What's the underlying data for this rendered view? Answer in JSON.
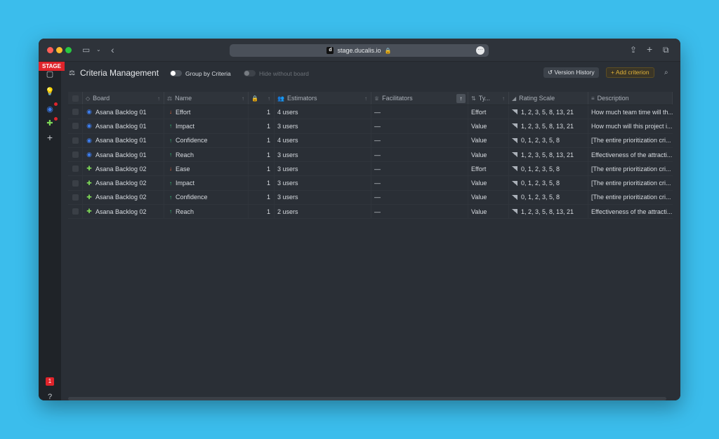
{
  "browser": {
    "url": "stage.ducalis.io",
    "favicon_letter": "d"
  },
  "sidebar": {
    "stage_label": "STAGE",
    "notification_count": "1"
  },
  "header": {
    "title": "Criteria Management",
    "group_by_label": "Group by Criteria",
    "hide_without_board_label": "Hide without board",
    "version_history_label": "Version History",
    "add_criterion_label": "Add criterion"
  },
  "table": {
    "columns": {
      "board": "Board",
      "name": "Name",
      "estimators": "Estimators",
      "facilitators": "Facilitators",
      "type": "Ty...",
      "rating_scale": "Rating Scale",
      "description": "Description"
    },
    "rows": [
      {
        "board": "Asana Backlog 01",
        "board_icon": "asana",
        "direction": "down",
        "name": "Effort",
        "lock": "1",
        "estimators": "4 users",
        "facilitators": "—",
        "type": "Effort",
        "scale": "1, 2, 3, 5, 8, 13, 21",
        "description": "How much team time will th..."
      },
      {
        "board": "Asana Backlog 01",
        "board_icon": "asana",
        "direction": "up",
        "name": "Impact",
        "lock": "1",
        "estimators": "3 users",
        "facilitators": "—",
        "type": "Value",
        "scale": "1, 2, 3, 5, 8, 13, 21",
        "description": "How much will this project i..."
      },
      {
        "board": "Asana Backlog 01",
        "board_icon": "asana",
        "direction": "up",
        "name": "Confidence",
        "lock": "1",
        "estimators": "4 users",
        "facilitators": "—",
        "type": "Value",
        "scale": "0, 1, 2, 3, 5, 8",
        "description": "[The entire prioritization cri..."
      },
      {
        "board": "Asana Backlog 01",
        "board_icon": "asana",
        "direction": "up",
        "name": "Reach",
        "lock": "1",
        "estimators": "3 users",
        "facilitators": "—",
        "type": "Value",
        "scale": "1, 2, 3, 5, 8, 13, 21",
        "description": "Effectiveness of the attracti..."
      },
      {
        "board": "Asana Backlog 02",
        "board_icon": "puzzle",
        "direction": "down",
        "name": "Ease",
        "lock": "1",
        "estimators": "3 users",
        "facilitators": "—",
        "type": "Effort",
        "scale": "0, 1, 2, 3, 5, 8",
        "description": "[The entire prioritization cri..."
      },
      {
        "board": "Asana Backlog 02",
        "board_icon": "puzzle",
        "direction": "up",
        "name": "Impact",
        "lock": "1",
        "estimators": "3 users",
        "facilitators": "—",
        "type": "Value",
        "scale": "0, 1, 2, 3, 5, 8",
        "description": "[The entire prioritization cri..."
      },
      {
        "board": "Asana Backlog 02",
        "board_icon": "puzzle",
        "direction": "up",
        "name": "Confidence",
        "lock": "1",
        "estimators": "3 users",
        "facilitators": "—",
        "type": "Value",
        "scale": "0, 1, 2, 3, 5, 8",
        "description": "[The entire prioritization cri..."
      },
      {
        "board": "Asana Backlog 02",
        "board_icon": "puzzle",
        "direction": "up",
        "name": "Reach",
        "lock": "1",
        "estimators": "2 users",
        "facilitators": "—",
        "type": "Value",
        "scale": "1, 2, 3, 5, 8, 13, 21",
        "description": "Effectiveness of the attracti..."
      }
    ]
  }
}
